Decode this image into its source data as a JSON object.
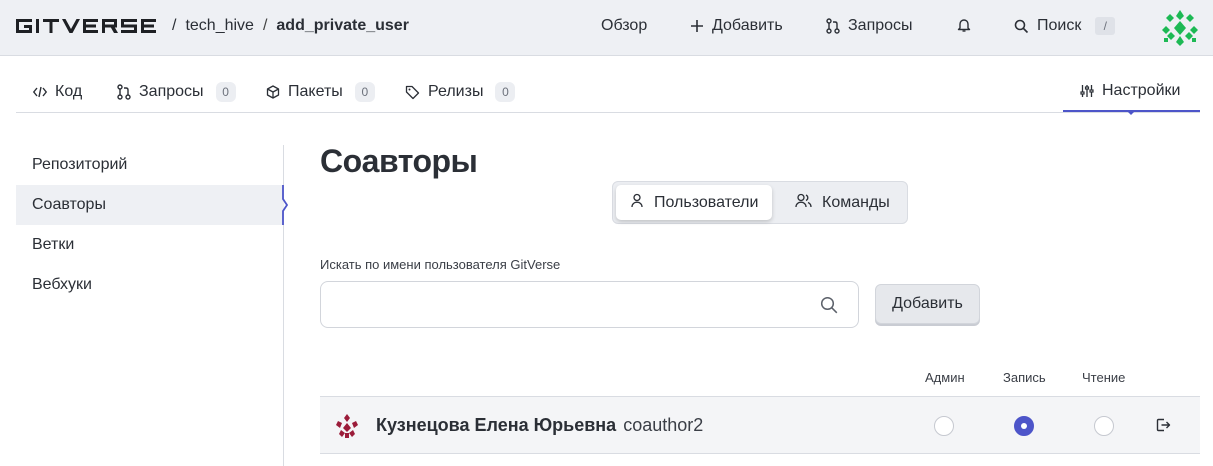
{
  "header": {
    "logo_text": "GITVERSE",
    "breadcrumb": {
      "owner": "tech_hive",
      "separator": "/",
      "repo": "add_private_user"
    },
    "nav": {
      "overview": "Обзор",
      "add": "Добавить",
      "requests": "Запросы",
      "search": "Поиск",
      "search_shortcut": "/"
    }
  },
  "tabs": [
    {
      "label": "Код",
      "icon": "code-icon"
    },
    {
      "label": "Запросы",
      "count": "0",
      "icon": "pull-request-icon"
    },
    {
      "label": "Пакеты",
      "count": "0",
      "icon": "package-icon"
    },
    {
      "label": "Релизы",
      "count": "0",
      "icon": "tag-icon"
    },
    {
      "label": "Настройки",
      "icon": "sliders-icon",
      "active": true
    }
  ],
  "sidebar": {
    "items": [
      {
        "label": "Репозиторий"
      },
      {
        "label": "Соавторы",
        "active": true
      },
      {
        "label": "Ветки"
      },
      {
        "label": "Вебхуки"
      }
    ]
  },
  "main": {
    "title": "Соавторы",
    "segments": [
      {
        "label": "Пользователи",
        "icon": "user-icon",
        "active": true
      },
      {
        "label": "Команды",
        "icon": "users-icon"
      }
    ],
    "search": {
      "label": "Искать по имени пользователя GitVerse",
      "placeholder": ""
    },
    "add_button": "Добавить",
    "columns": {
      "admin": "Админ",
      "write": "Запись",
      "read": "Чтение"
    },
    "users": [
      {
        "name": "Кузнецова Елена Юрьевна",
        "login": "coauthor2",
        "permission": "write"
      }
    ]
  },
  "colors": {
    "accent": "#4d55c9",
    "header_bg": "#eef0f4",
    "avatar_green": "#1db954",
    "avatar_red": "#9b1c3a"
  }
}
